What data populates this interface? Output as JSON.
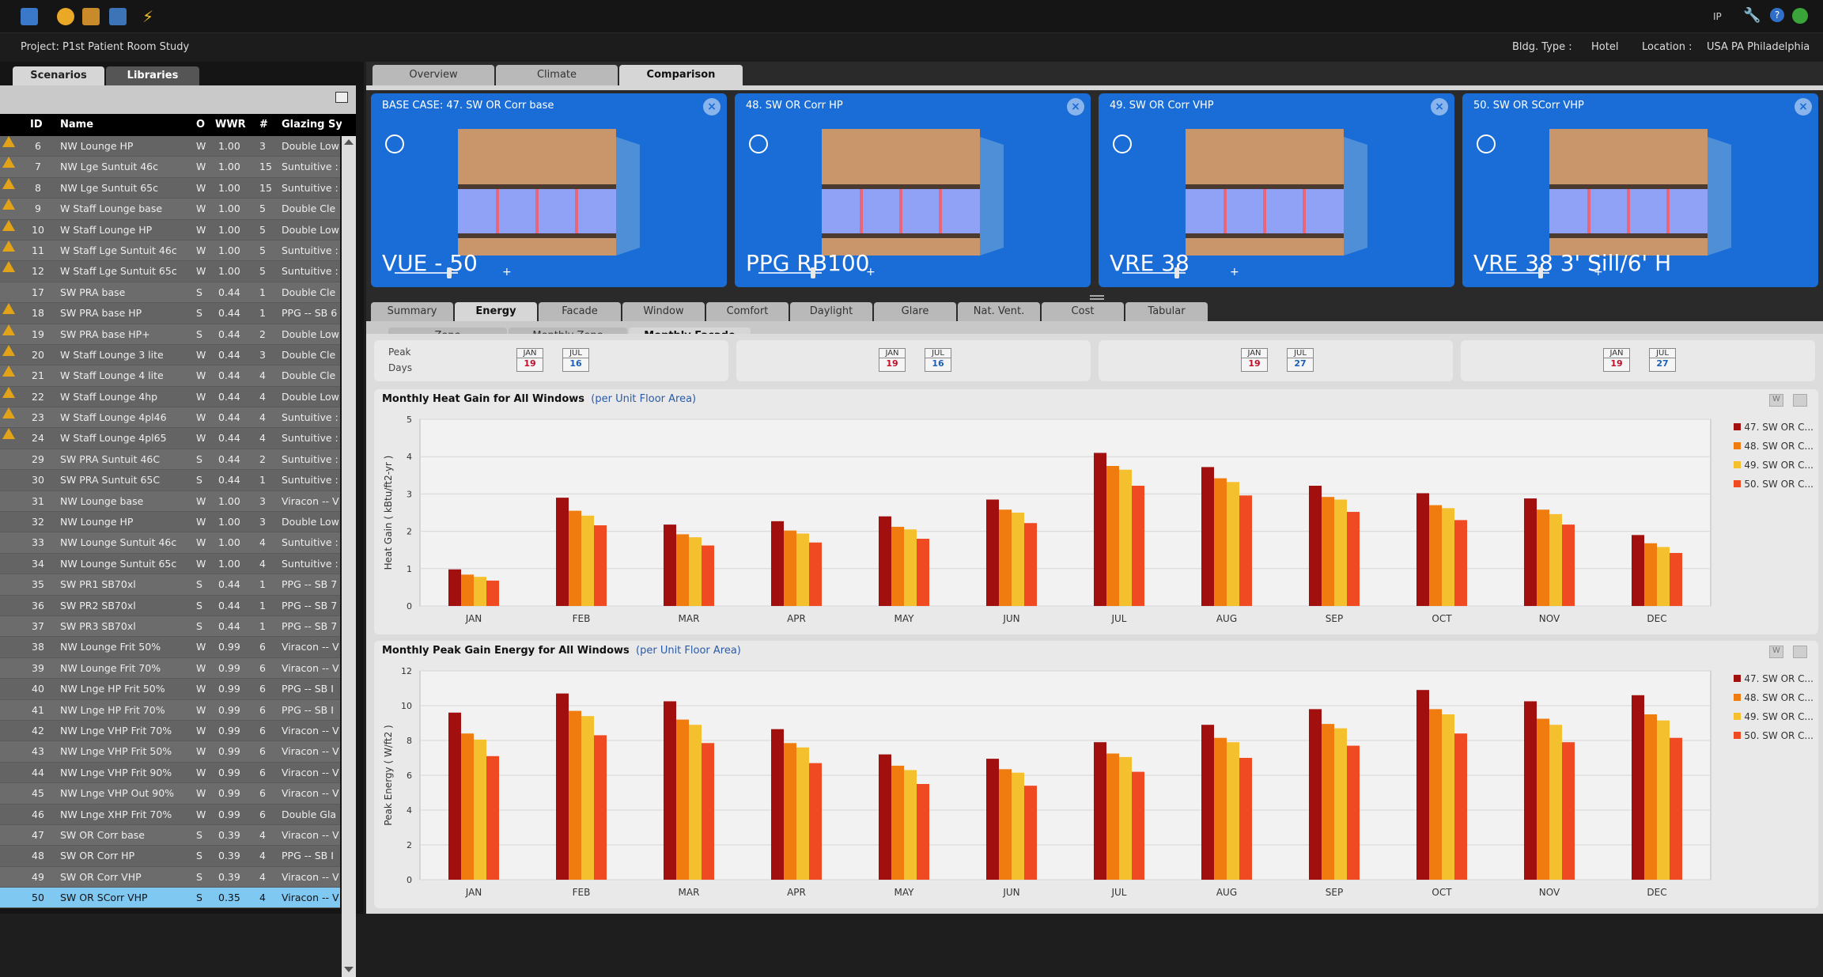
{
  "topbar": {
    "units": "IP"
  },
  "project": {
    "label": "Project: P1st Patient Room Study",
    "bldg_type_label": "Bldg. Type :",
    "bldg_type": "Hotel",
    "location_label": "Location :",
    "location": "USA PA Philadelphia"
  },
  "sidebar": {
    "tabs": [
      "Scenarios",
      "Libraries"
    ],
    "columns": [
      "ID",
      "Name",
      "O",
      "WWR",
      "#",
      "Glazing Sys"
    ],
    "rows": [
      {
        "warn": true,
        "id": "6",
        "name": "NW Lounge HP",
        "o": "W",
        "wwr": "1.00",
        "n": "3",
        "glazing": "Double Low"
      },
      {
        "warn": true,
        "id": "7",
        "name": "NW Lge Suntuit 46c",
        "o": "W",
        "wwr": "1.00",
        "n": "15",
        "glazing": "Suntuitive :"
      },
      {
        "warn": true,
        "id": "8",
        "name": "NW Lge Suntuit 65c",
        "o": "W",
        "wwr": "1.00",
        "n": "15",
        "glazing": "Suntuitive :"
      },
      {
        "warn": true,
        "id": "9",
        "name": "W Staff Lounge base",
        "o": "W",
        "wwr": "1.00",
        "n": "5",
        "glazing": "Double Cle"
      },
      {
        "warn": true,
        "id": "10",
        "name": "W Staff Lounge HP",
        "o": "W",
        "wwr": "1.00",
        "n": "5",
        "glazing": "Double Low"
      },
      {
        "warn": true,
        "id": "11",
        "name": "W Staff Lge Suntuit 46c",
        "o": "W",
        "wwr": "1.00",
        "n": "5",
        "glazing": "Suntuitive :"
      },
      {
        "warn": true,
        "id": "12",
        "name": "W Staff Lge Suntuit 65c",
        "o": "W",
        "wwr": "1.00",
        "n": "5",
        "glazing": "Suntuitive :"
      },
      {
        "warn": false,
        "id": "17",
        "name": "SW PRA base",
        "o": "S",
        "wwr": "0.44",
        "n": "1",
        "glazing": "Double Cle"
      },
      {
        "warn": true,
        "id": "18",
        "name": "SW PRA base HP",
        "o": "S",
        "wwr": "0.44",
        "n": "1",
        "glazing": "PPG -- SB 6"
      },
      {
        "warn": true,
        "id": "19",
        "name": "SW PRA base HP+",
        "o": "S",
        "wwr": "0.44",
        "n": "2",
        "glazing": "Double Low"
      },
      {
        "warn": true,
        "id": "20",
        "name": "W Staff Lounge 3 lite",
        "o": "W",
        "wwr": "0.44",
        "n": "3",
        "glazing": "Double Cle"
      },
      {
        "warn": true,
        "id": "21",
        "name": "W Staff Lounge 4 lite",
        "o": "W",
        "wwr": "0.44",
        "n": "4",
        "glazing": "Double Cle"
      },
      {
        "warn": true,
        "id": "22",
        "name": "W Staff Lounge 4hp",
        "o": "W",
        "wwr": "0.44",
        "n": "4",
        "glazing": "Double Low"
      },
      {
        "warn": true,
        "id": "23",
        "name": "W Staff Lounge 4pl46",
        "o": "W",
        "wwr": "0.44",
        "n": "4",
        "glazing": "Suntuitive :"
      },
      {
        "warn": true,
        "id": "24",
        "name": "W Staff Lounge 4pl65",
        "o": "W",
        "wwr": "0.44",
        "n": "4",
        "glazing": "Suntuitive :"
      },
      {
        "warn": false,
        "id": "29",
        "name": "SW PRA Suntuit 46C",
        "o": "S",
        "wwr": "0.44",
        "n": "2",
        "glazing": "Suntuitive :"
      },
      {
        "warn": false,
        "id": "30",
        "name": "SW PRA Suntuit 65C",
        "o": "S",
        "wwr": "0.44",
        "n": "1",
        "glazing": "Suntuitive :"
      },
      {
        "warn": false,
        "id": "31",
        "name": "NW Lounge base",
        "o": "W",
        "wwr": "1.00",
        "n": "3",
        "glazing": "Viracon -- V"
      },
      {
        "warn": false,
        "id": "32",
        "name": "NW Lounge HP",
        "o": "W",
        "wwr": "1.00",
        "n": "3",
        "glazing": "Double Low"
      },
      {
        "warn": false,
        "id": "33",
        "name": "NW Lounge Suntuit 46c",
        "o": "W",
        "wwr": "1.00",
        "n": "4",
        "glazing": "Suntuitive :"
      },
      {
        "warn": false,
        "id": "34",
        "name": "NW Lounge Suntuit 65c",
        "o": "W",
        "wwr": "1.00",
        "n": "4",
        "glazing": "Suntuitive :"
      },
      {
        "warn": false,
        "id": "35",
        "name": "SW PR1 SB70xl",
        "o": "S",
        "wwr": "0.44",
        "n": "1",
        "glazing": "PPG -- SB 7"
      },
      {
        "warn": false,
        "id": "36",
        "name": "SW PR2 SB70xl",
        "o": "S",
        "wwr": "0.44",
        "n": "1",
        "glazing": "PPG -- SB 7"
      },
      {
        "warn": false,
        "id": "37",
        "name": "SW PR3 SB70xl",
        "o": "S",
        "wwr": "0.44",
        "n": "1",
        "glazing": "PPG -- SB 7"
      },
      {
        "warn": false,
        "id": "38",
        "name": "NW Lounge Frit 50%",
        "o": "W",
        "wwr": "0.99",
        "n": "6",
        "glazing": "Viracon -- V"
      },
      {
        "warn": false,
        "id": "39",
        "name": "NW Lounge Frit 70%",
        "o": "W",
        "wwr": "0.99",
        "n": "6",
        "glazing": "Viracon -- V"
      },
      {
        "warn": false,
        "id": "40",
        "name": "NW Lnge HP Frit 50%",
        "o": "W",
        "wwr": "0.99",
        "n": "6",
        "glazing": "PPG -- SB I"
      },
      {
        "warn": false,
        "id": "41",
        "name": "NW Lnge HP Frit 70%",
        "o": "W",
        "wwr": "0.99",
        "n": "6",
        "glazing": "PPG -- SB I"
      },
      {
        "warn": false,
        "id": "42",
        "name": "NW Lnge VHP Frit 70%",
        "o": "W",
        "wwr": "0.99",
        "n": "6",
        "glazing": "Viracon -- V"
      },
      {
        "warn": false,
        "id": "43",
        "name": "NW Lnge VHP Frit 50%",
        "o": "W",
        "wwr": "0.99",
        "n": "6",
        "glazing": "Viracon -- V"
      },
      {
        "warn": false,
        "id": "44",
        "name": "NW Lnge VHP Frit 90%",
        "o": "W",
        "wwr": "0.99",
        "n": "6",
        "glazing": "Viracon -- V"
      },
      {
        "warn": false,
        "id": "45",
        "name": "NW Lnge VHP Out 90%",
        "o": "W",
        "wwr": "0.99",
        "n": "6",
        "glazing": "Viracon -- V"
      },
      {
        "warn": false,
        "id": "46",
        "name": "NW Lnge XHP Frit 70%",
        "o": "W",
        "wwr": "0.99",
        "n": "6",
        "glazing": "Double Gla"
      },
      {
        "warn": false,
        "id": "47",
        "name": "SW OR Corr base",
        "o": "S",
        "wwr": "0.39",
        "n": "4",
        "glazing": "Viracon -- V"
      },
      {
        "warn": false,
        "id": "48",
        "name": "SW OR Corr HP",
        "o": "S",
        "wwr": "0.39",
        "n": "4",
        "glazing": "PPG -- SB I"
      },
      {
        "warn": false,
        "id": "49",
        "name": "SW OR Corr VHP",
        "o": "S",
        "wwr": "0.39",
        "n": "4",
        "glazing": "Viracon -- V"
      },
      {
        "warn": false,
        "id": "50",
        "name": "SW OR SCorr VHP",
        "o": "S",
        "wwr": "0.35",
        "n": "4",
        "glazing": "Viracon -- V",
        "selected": true
      }
    ]
  },
  "main_tabs": [
    "Overview",
    "Climate",
    "Comparison"
  ],
  "cards": [
    {
      "title": "BASE CASE: 47. SW OR Corr base",
      "label": "VUE - 50"
    },
    {
      "title": "48. SW OR Corr HP",
      "label": "PPG RB100"
    },
    {
      "title": "49. SW OR Corr VHP",
      "label": "VRE 38"
    },
    {
      "title": "50. SW OR SCorr VHP",
      "label": "VRE 38 3' Sill/6' H"
    }
  ],
  "analysis_tabs": [
    "Summary",
    "Energy",
    "Facade",
    "Window",
    "Comfort",
    "Daylight",
    "Glare",
    "Nat. Vent.",
    "Cost",
    "Tabular"
  ],
  "view_tabs": [
    "Zone",
    "Monthly Zone",
    "Monthly Facade"
  ],
  "peak_days": {
    "label_peak": "Peak",
    "label_days": "Days",
    "boxes": [
      {
        "h_month": "JAN",
        "h_day": "19",
        "c_month": "JUL",
        "c_day": "16"
      },
      {
        "h_month": "JAN",
        "h_day": "19",
        "c_month": "JUL",
        "c_day": "16"
      },
      {
        "h_month": "JAN",
        "h_day": "19",
        "c_month": "JUL",
        "c_day": "27"
      },
      {
        "h_month": "JAN",
        "h_day": "19",
        "c_month": "JUL",
        "c_day": "27"
      }
    ]
  },
  "colors": [
    "#a10f0f",
    "#f07c10",
    "#f5c02e",
    "#ef4a22"
  ],
  "chart_data": [
    {
      "type": "bar",
      "title": "Monthly Heat Gain for All Windows",
      "subtitle": "(per Unit Floor Area)",
      "ylabel": "Heat Gain ( kBtu/ft2-yr )",
      "ylim": [
        0,
        5
      ],
      "yticks": [
        0,
        1,
        2,
        3,
        4,
        5
      ],
      "categories": [
        "JAN",
        "FEB",
        "MAR",
        "APR",
        "MAY",
        "JUN",
        "JUL",
        "AUG",
        "SEP",
        "OCT",
        "NOV",
        "DEC"
      ],
      "series": [
        {
          "name": "47. SW OR C...",
          "values": [
            0.98,
            2.9,
            2.18,
            2.27,
            2.4,
            2.85,
            4.1,
            3.72,
            3.22,
            3.02,
            2.88,
            1.9
          ]
        },
        {
          "name": "48. SW OR C...",
          "values": [
            0.84,
            2.55,
            1.92,
            2.02,
            2.12,
            2.58,
            3.75,
            3.42,
            2.92,
            2.7,
            2.58,
            1.68
          ]
        },
        {
          "name": "49. SW OR C...",
          "values": [
            0.78,
            2.42,
            1.84,
            1.94,
            2.05,
            2.5,
            3.65,
            3.32,
            2.85,
            2.62,
            2.46,
            1.58
          ]
        },
        {
          "name": "50. SW OR C...",
          "values": [
            0.68,
            2.16,
            1.62,
            1.7,
            1.8,
            2.22,
            3.22,
            2.96,
            2.52,
            2.3,
            2.18,
            1.42
          ]
        }
      ],
      "legend": "right"
    },
    {
      "type": "bar",
      "title": "Monthly Peak Gain Energy for All Windows",
      "subtitle": "(per Unit Floor Area)",
      "ylabel": "Peak Energy ( W/ft2 )",
      "ylim": [
        0,
        12
      ],
      "yticks": [
        0,
        2,
        4,
        6,
        8,
        10,
        12
      ],
      "categories": [
        "JAN",
        "FEB",
        "MAR",
        "APR",
        "MAY",
        "JUN",
        "JUL",
        "AUG",
        "SEP",
        "OCT",
        "NOV",
        "DEC"
      ],
      "series": [
        {
          "name": "47. SW OR C...",
          "values": [
            9.6,
            10.7,
            10.25,
            8.65,
            7.2,
            6.95,
            7.9,
            8.9,
            9.8,
            10.9,
            10.25,
            10.6
          ]
        },
        {
          "name": "48. SW OR C...",
          "values": [
            8.4,
            9.7,
            9.2,
            7.85,
            6.55,
            6.35,
            7.25,
            8.15,
            8.95,
            9.8,
            9.25,
            9.5
          ]
        },
        {
          "name": "49. SW OR C...",
          "values": [
            8.05,
            9.4,
            8.9,
            7.6,
            6.3,
            6.15,
            7.05,
            7.9,
            8.7,
            9.5,
            8.9,
            9.15
          ]
        },
        {
          "name": "50. SW OR C...",
          "values": [
            7.1,
            8.3,
            7.85,
            6.7,
            5.5,
            5.4,
            6.2,
            7.0,
            7.7,
            8.4,
            7.9,
            8.15
          ]
        }
      ],
      "legend": "right"
    }
  ]
}
